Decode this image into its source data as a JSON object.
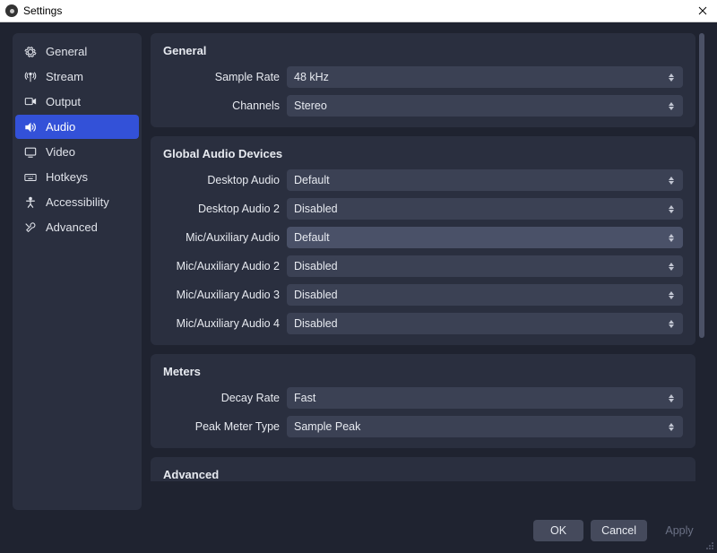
{
  "window": {
    "title": "Settings"
  },
  "sidebar": {
    "items": [
      {
        "id": "general",
        "label": "General"
      },
      {
        "id": "stream",
        "label": "Stream"
      },
      {
        "id": "output",
        "label": "Output"
      },
      {
        "id": "audio",
        "label": "Audio"
      },
      {
        "id": "video",
        "label": "Video"
      },
      {
        "id": "hotkeys",
        "label": "Hotkeys"
      },
      {
        "id": "accessibility",
        "label": "Accessibility"
      },
      {
        "id": "advanced",
        "label": "Advanced"
      }
    ],
    "active": "audio"
  },
  "sections": {
    "general": {
      "title": "General",
      "rows": {
        "sample_rate": {
          "label": "Sample Rate",
          "value": "48 kHz"
        },
        "channels": {
          "label": "Channels",
          "value": "Stereo"
        }
      }
    },
    "devices": {
      "title": "Global Audio Devices",
      "rows": {
        "desktop1": {
          "label": "Desktop Audio",
          "value": "Default"
        },
        "desktop2": {
          "label": "Desktop Audio 2",
          "value": "Disabled"
        },
        "mic1": {
          "label": "Mic/Auxiliary Audio",
          "value": "Default"
        },
        "mic2": {
          "label": "Mic/Auxiliary Audio 2",
          "value": "Disabled"
        },
        "mic3": {
          "label": "Mic/Auxiliary Audio 3",
          "value": "Disabled"
        },
        "mic4": {
          "label": "Mic/Auxiliary Audio 4",
          "value": "Disabled"
        }
      }
    },
    "meters": {
      "title": "Meters",
      "rows": {
        "decay": {
          "label": "Decay Rate",
          "value": "Fast"
        },
        "peak_type": {
          "label": "Peak Meter Type",
          "value": "Sample Peak"
        }
      }
    },
    "advanced": {
      "title": "Advanced"
    }
  },
  "footer": {
    "ok": "OK",
    "cancel": "Cancel",
    "apply": "Apply"
  }
}
